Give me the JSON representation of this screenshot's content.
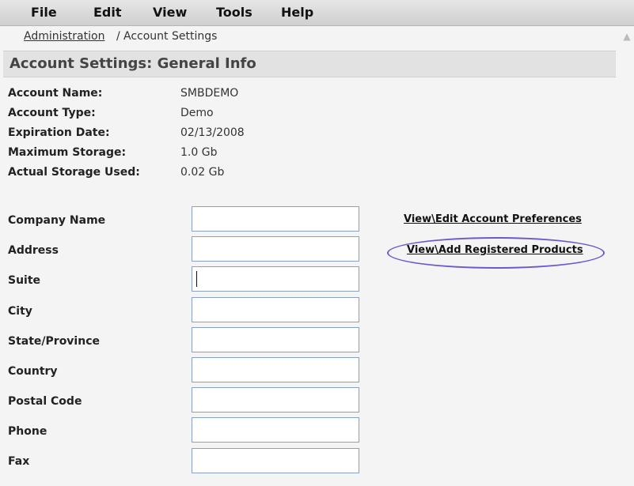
{
  "menubar": {
    "items": [
      "File",
      "Edit",
      "View",
      "Tools",
      "Help"
    ]
  },
  "breadcrumb": {
    "parent": "Administration",
    "separator": "/",
    "current": "Account Settings"
  },
  "section": {
    "title": "Account Settings: General Info"
  },
  "account_info": [
    {
      "label": "Account Name:",
      "value": "SMBDEMO"
    },
    {
      "label": "Account Type:",
      "value": "Demo"
    },
    {
      "label": "Expiration Date:",
      "value": "02/13/2008"
    },
    {
      "label": "Maximum Storage:",
      "value": "1.0 Gb"
    },
    {
      "label": "Actual Storage Used:",
      "value": "0.02 Gb"
    }
  ],
  "form_fields": [
    {
      "label": "Company Name",
      "value": ""
    },
    {
      "label": "Address",
      "value": ""
    },
    {
      "label": "Suite",
      "value": ""
    },
    {
      "label": "City",
      "value": ""
    },
    {
      "label": "State/Province",
      "value": ""
    },
    {
      "label": "Country",
      "value": ""
    },
    {
      "label": "Postal Code",
      "value": ""
    },
    {
      "label": "Phone",
      "value": ""
    },
    {
      "label": "Fax",
      "value": ""
    }
  ],
  "links": {
    "account_preferences": "View\\Edit Account Preferences",
    "registered_products": "View\\Add Registered Products"
  },
  "colors": {
    "highlight": "#6a5acd",
    "input_border": "#8aa0c0"
  }
}
